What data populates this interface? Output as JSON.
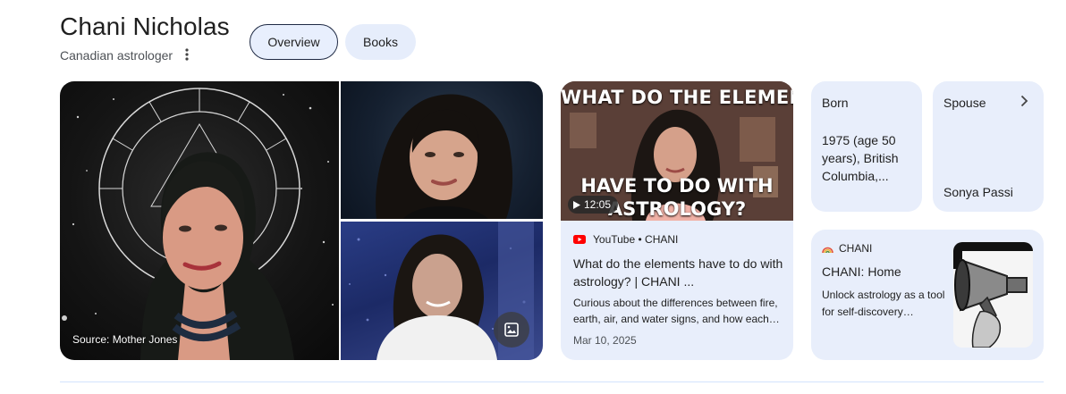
{
  "entity": {
    "name": "Chani Nicholas",
    "description": "Canadian astrologer"
  },
  "tabs": [
    {
      "label": "Overview",
      "selected": true
    },
    {
      "label": "Books",
      "selected": false
    }
  ],
  "images": {
    "source_caption": "Source: Mother Jones"
  },
  "video": {
    "thumbnail_text_top": "WHAT DO THE ELEMENTS",
    "thumbnail_text_bottom_1": "HAVE TO DO WITH",
    "thumbnail_text_bottom_2": "ASTROLOGY?",
    "duration": "12:05",
    "source": "YouTube • CHANI",
    "title": "What do the elements have to do with astrology? | CHANI ...",
    "description": "Curious about the differences between fire, earth, air, and water signs, and how each…",
    "date": "Mar 10, 2025"
  },
  "facts": {
    "born_label": "Born",
    "born_value": "1975 (age 50 years), British Columbia,...",
    "spouse_label": "Spouse",
    "spouse_value": "Sonya Passi"
  },
  "website": {
    "site_name": "CHANI",
    "title": "CHANI: Home",
    "description": "Unlock astrology as a tool for self-discovery…"
  },
  "colors": {
    "card_bg": "#e8eefb",
    "youtube_red": "#ff0000",
    "text": "#1f1f1f"
  }
}
